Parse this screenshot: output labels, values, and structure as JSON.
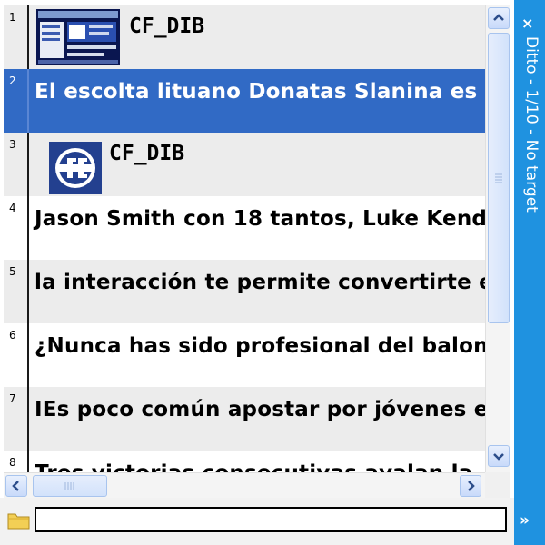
{
  "window": {
    "caption_title": "Ditto - 1/10 - No target",
    "close_glyph": "×",
    "expand_glyph": "»",
    "accent_color": "#1f92e0",
    "selection_color": "#316ac5"
  },
  "clips": [
    {
      "num": "1",
      "type": "image",
      "label": "CF_DIB",
      "icon": "screenshot-thumbnail"
    },
    {
      "num": "2",
      "type": "text",
      "text": "El escolta lituano Donatas Slanina es",
      "selected": true
    },
    {
      "num": "3",
      "type": "image",
      "label": "CF_DIB",
      "icon": "fe-logo-thumbnail"
    },
    {
      "num": "4",
      "type": "text",
      "text": "Jason Smith con 18 tantos, Luke Kend"
    },
    {
      "num": "5",
      "type": "text",
      "text": "la interacción te permite convertirte en"
    },
    {
      "num": "6",
      "type": "text",
      "text": "¿Nunca has sido profesional del balon"
    },
    {
      "num": "7",
      "type": "text",
      "text": "IEs poco común apostar por jóvenes e"
    },
    {
      "num": "8",
      "type": "text",
      "text": "Tres victorias consecutivas avalan la"
    }
  ],
  "search": {
    "value": "",
    "placeholder": ""
  },
  "icons": {
    "scroll_up": "scroll-up-arrow-icon",
    "scroll_down": "scroll-down-arrow-icon",
    "scroll_left": "scroll-left-arrow-icon",
    "scroll_right": "scroll-right-arrow-icon",
    "folder": "folder-icon"
  }
}
